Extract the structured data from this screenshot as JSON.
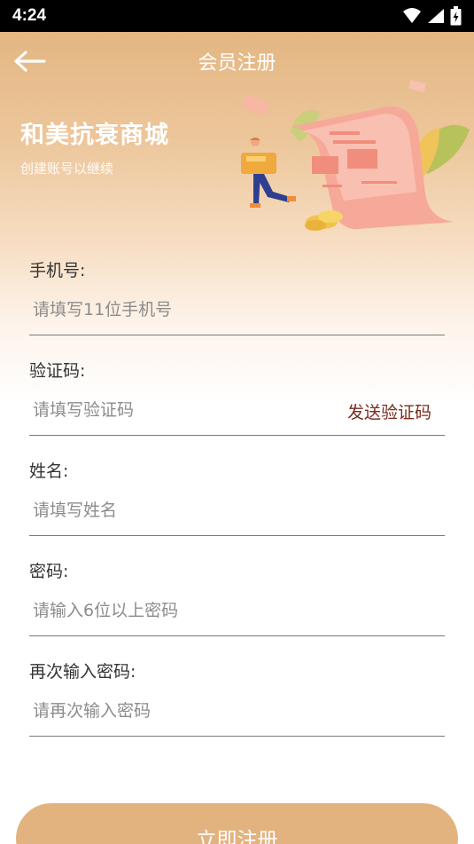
{
  "status_bar": {
    "time": "4:24"
  },
  "nav": {
    "title": "会员注册"
  },
  "brand": {
    "name": "和美抗衰商城",
    "subtitle": "创建账号以继续"
  },
  "form": {
    "phone": {
      "label": "手机号:",
      "placeholder": "请填写11位手机号",
      "value": ""
    },
    "code": {
      "label": "验证码:",
      "placeholder": "请填写验证码",
      "value": "",
      "send_label": "发送验证码"
    },
    "name": {
      "label": "姓名:",
      "placeholder": "请填写姓名",
      "value": ""
    },
    "password": {
      "label": "密码:",
      "placeholder": "请输入6位以上密码",
      "value": ""
    },
    "confirm": {
      "label": "再次输入密码:",
      "placeholder": "请再次输入密码",
      "value": ""
    }
  },
  "submit_label": "立即注册",
  "colors": {
    "accent": "#e3b37f",
    "header_top": "#e3b682",
    "link": "#7a2a1e",
    "status_bar": "#000000"
  },
  "icons": [
    "wifi-icon",
    "signal-icon",
    "battery-icon",
    "back-arrow-icon",
    "receipt-illustration"
  ]
}
